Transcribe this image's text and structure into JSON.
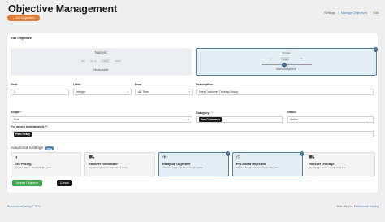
{
  "header": {
    "title": "Objective Management",
    "objectives_button": "List Objectives",
    "breadcrumb": [
      "Settings",
      "Manage Objectives",
      "Edit"
    ]
  },
  "form": {
    "card_title": "Edit Objective",
    "types": {
      "numeric": {
        "title": "Numeric",
        "sub": "Measurable",
        "min": "100",
        "out_of": "out of",
        "value": "100",
        "pct": "100%"
      },
      "scale": {
        "title": "Scale",
        "sub": "Main Subjective",
        "min": "1",
        "value": "1/5",
        "max": "3/5",
        "selected": true
      }
    },
    "fields": {
      "goal": {
        "label": "Goal",
        "value": "1"
      },
      "units": {
        "label": "Units",
        "value": "Integer"
      },
      "freq": {
        "label": "Freq",
        "value": "All-Time"
      },
      "description": {
        "label": "Description",
        "value": "New Customer Training Setup"
      },
      "scope": {
        "label": "Scope*",
        "value": "Role"
      },
      "category": {
        "label": "Category",
        "tag": "New Customers"
      },
      "status": {
        "label": "Status",
        "value": "Active"
      },
      "for_which": {
        "label": "For which individual(s)?*",
        "tag": "Plain Ready"
      }
    },
    "advanced": {
      "title": "Advanced Settings",
      "badge": "Beta",
      "options": [
        {
          "label": "Use Pacing",
          "desc": "Objective will use Monthly Rolling goals.",
          "icon": "gauge-icon",
          "selected": false
        },
        {
          "label": "Rollover Remainder",
          "desc": "Any remainder carries over into the future.",
          "icon": "truck-icon",
          "selected": false
        },
        {
          "label": "Ramping Objective",
          "desc": "Objective \"ramps up\" over three (3) months.",
          "icon": "plane-icon",
          "selected": true
        },
        {
          "label": "Pro-Rated Objective",
          "desc": "Adjusted based on the employee's \"hire date\".",
          "icon": "clock-icon",
          "selected": true
        },
        {
          "label": "Rollover Overage",
          "desc": "Any overage carries over into the future.",
          "icon": "truck-icon",
          "selected": false
        }
      ]
    },
    "buttons": {
      "update": "Update Objective",
      "cancel": "Cancel"
    }
  },
  "footer": {
    "left": "PerformanceGaming © 2023",
    "right_prefix": "Built with ♥ by",
    "right_link": "Performance Gaming"
  },
  "colors": {
    "accent_orange": "#e07b35",
    "selected_border": "#4a7fa6",
    "update_green": "#3aa54a"
  }
}
